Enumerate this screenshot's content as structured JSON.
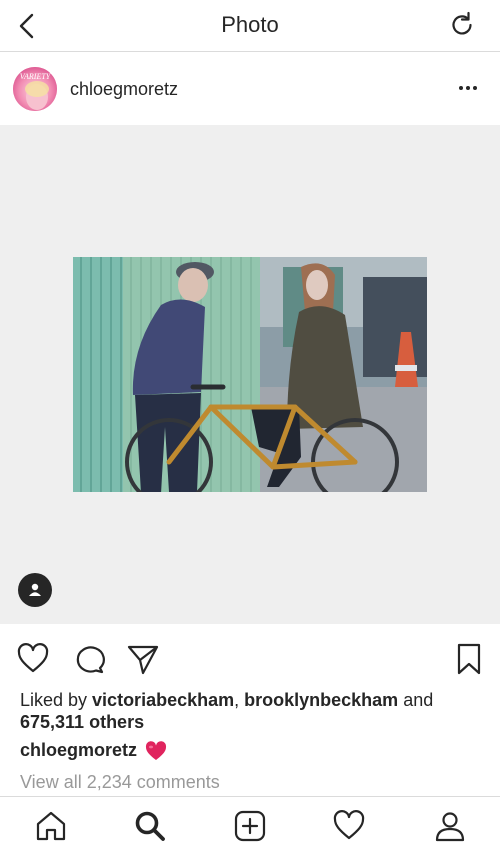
{
  "topbar": {
    "title": "Photo"
  },
  "post": {
    "username": "chloegmoretz",
    "avatar_text": "VARIETY"
  },
  "likes": {
    "prefix": "Liked by ",
    "user1": "victoriabeckham",
    "sep": ", ",
    "user2": "brooklynbeckham",
    "and": " and",
    "others": "675,311 others"
  },
  "caption": {
    "username": "chloegmoretz"
  },
  "comments": {
    "view_all": "View all 2,234 comments"
  },
  "icons": {
    "back": "chevron-left-icon",
    "refresh": "refresh-icon",
    "more": "more-icon",
    "like": "heart-icon",
    "comment": "comment-icon",
    "share": "send-icon",
    "save": "bookmark-icon",
    "tag": "person-tag-icon",
    "home": "home-icon",
    "search": "search-icon",
    "add": "add-icon",
    "activity": "heart-icon",
    "profile": "profile-icon"
  },
  "colors": {
    "heart_emoji": "#e0245e",
    "muted_text": "#999999",
    "photo_bg": "#efefef"
  }
}
